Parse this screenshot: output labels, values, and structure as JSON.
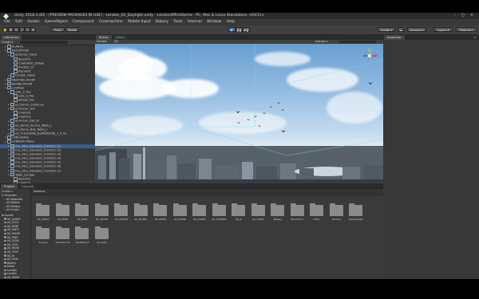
{
  "window": {
    "title": "Unity 2018.3.0f2 - [PREVIEW PACKAGES IN USE] - London_02_Daylight.unity - LondonOfficeDemo - PC, Mac & Linux Standalone <DX11>"
  },
  "menu": [
    "File",
    "Edit",
    "Assets",
    "GameObject",
    "Component",
    "Cinemachine",
    "Mobile Input",
    "Bakery",
    "Tools",
    "Internal",
    "Window",
    "Help"
  ],
  "toolbar": {
    "pivot": "Pivot",
    "global": "Global",
    "play_buttons": [
      "▶",
      "❚❚",
      "▶❚"
    ],
    "collab": "Collab ▾",
    "account": "Account ▾",
    "layers": "Layers ▾",
    "layout": "Default ▾"
  },
  "hierarchy": {
    "tab": "Hierarchy",
    "create": "Create ▾",
    "rows": [
      {
        "label": "PLANTS",
        "indent": 1
      },
      {
        "label": "RECEPTION",
        "indent": 1
      },
      {
        "label": "ethernet_mesh",
        "indent": 2
      },
      {
        "label": "Bench01",
        "indent": 3
      },
      {
        "label": "ChairHR01_Billow",
        "indent": 3
      },
      {
        "label": "Plant01_LT",
        "indent": 3
      },
      {
        "label": "Planet01",
        "indent": 3
      },
      {
        "label": "London_Glass",
        "indent": 2
      },
      {
        "label": "MEETING ROOM",
        "indent": 1
      },
      {
        "label": "BOARD ROOM",
        "indent": 1
      },
      {
        "label": "LOUNGE",
        "indent": 1
      },
      {
        "label": "sofa_3_fire",
        "indent": 2
      },
      {
        "label": "sofa_3_fire",
        "indent": 3
      },
      {
        "label": "pillows_fire",
        "indent": 3
      },
      {
        "label": "ed_Dome_Credenza",
        "indent": 2
      },
      {
        "label": "armchair_1b0",
        "indent": 2
      },
      {
        "label": "Chair01L",
        "indent": 3
      },
      {
        "label": "Chair01L",
        "indent": 3
      },
      {
        "label": "armchair_2a0_lit",
        "indent": 2
      },
      {
        "label": "ed_Dome_Source_Table_L",
        "indent": 2
      },
      {
        "label": "ed_Dome_Box_Table_L",
        "indent": 2
      },
      {
        "label": "ed_TLILGGERS_EGMSRDOW_1_0_01",
        "indent": 2
      },
      {
        "label": "CERLOVACE",
        "indent": 1
      },
      {
        "label": "LONDON TABLE",
        "indent": 1
      },
      {
        "label": "ma_vitra_standard_chair001 (1)",
        "indent": 2
      },
      {
        "label": "ma_vitra_standard_chair001 (2)",
        "indent": 2
      },
      {
        "label": "ma_vitra_standard_chair001 (3)",
        "indent": 2
      },
      {
        "label": "ma_vitra_standard_chair001 (4)",
        "indent": 2
      },
      {
        "label": "ma_vitra_standard_chair001 (5)",
        "indent": 2
      },
      {
        "label": "ma_vitra_standard_chair001 (6)",
        "indent": 2
      },
      {
        "label": "ma_vitra_standard_chair001 (7)",
        "indent": 2
      },
      {
        "label": "Table_Lounge",
        "indent": 2
      },
      {
        "label": "Bench01",
        "indent": 3
      },
      {
        "label": "Chair01L",
        "indent": 3
      }
    ]
  },
  "scene": {
    "tabs": [
      "Scene",
      "Game"
    ],
    "shaded": "Shaded",
    "mode_2d": "2D",
    "gizmos": "Gizmos ▾",
    "search_all": "All"
  },
  "project": {
    "tabs": [
      "Project",
      "Console"
    ],
    "create": "Create ▾",
    "breadcrumb": "Assets ▸",
    "favorites": [
      "Favorites",
      "All Materials",
      "All Models",
      "All Prefabs",
      "All Scripts"
    ],
    "tree": [
      "Assets",
      "00_AUDIO",
      "00_ESCE",
      "00_HDRI",
      "00_MATE",
      "00_MODE",
      "00_PREF",
      "00_SCEN",
      "00_SCRI",
      "00_SHAD",
      "00_TEXT",
      "00_UI",
      "00_VIDE",
      "Bakery",
      "Editor",
      "London",
      "London",
      "00_GRAB",
      "00_GRAB",
      "00_GRAB",
      "00_GRAB",
      "00_GRAB"
    ],
    "folders": [
      "00_AUDIO",
      "00_ESCE",
      "00_HDRI",
      "00_MODE",
      "00_WATER",
      "00_MODEL",
      "00_PREFA",
      "00_SCENE",
      "00_SCRIPT",
      "00_SHADER",
      "00_UI",
      "00_VIDEO",
      "Bakery",
      "Bird Paid L",
      "Editor",
      "Gizmos",
      "KeenaGraph",
      "Scenes",
      "Standard Fa",
      "TextMesh P",
      "[Scripts]"
    ]
  },
  "inspector": {
    "tab": "Inspector"
  }
}
